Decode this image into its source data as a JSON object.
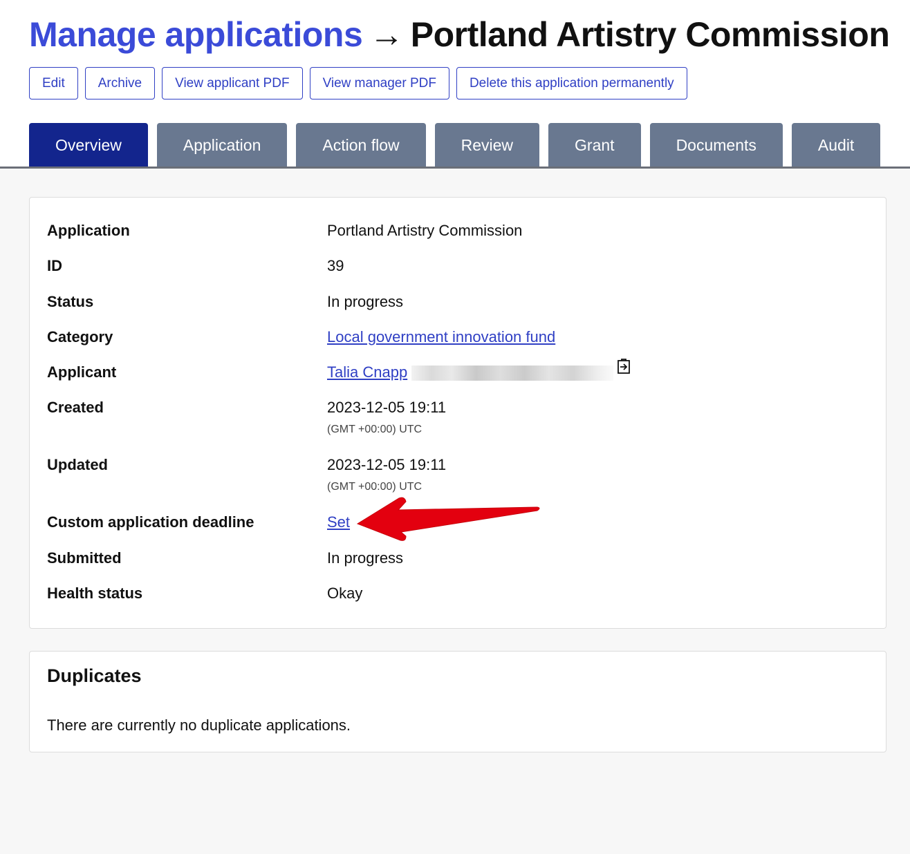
{
  "breadcrumb": {
    "parent": "Manage applications",
    "separator": "→",
    "current": "Portland Artistry Commission"
  },
  "actions": [
    {
      "label": "Edit"
    },
    {
      "label": "Archive"
    },
    {
      "label": "View applicant PDF"
    },
    {
      "label": "View manager PDF"
    },
    {
      "label": "Delete this application permanently"
    }
  ],
  "tabs": [
    {
      "label": "Overview",
      "active": true
    },
    {
      "label": "Application",
      "active": false
    },
    {
      "label": "Action flow",
      "active": false
    },
    {
      "label": "Review",
      "active": false
    },
    {
      "label": "Grant",
      "active": false
    },
    {
      "label": "Documents",
      "active": false
    },
    {
      "label": "Audit",
      "active": false
    }
  ],
  "overview": {
    "application": {
      "label": "Application",
      "value": "Portland Artistry Commission"
    },
    "id": {
      "label": "ID",
      "value": "39"
    },
    "status": {
      "label": "Status",
      "value": "In progress"
    },
    "category": {
      "label": "Category",
      "value": "Local government innovation fund"
    },
    "applicant": {
      "label": "Applicant",
      "value": "Talia Cnapp"
    },
    "created": {
      "label": "Created",
      "value": "2023-12-05 19:11",
      "timezone": "(GMT +00:00) UTC"
    },
    "updated": {
      "label": "Updated",
      "value": "2023-12-05 19:11",
      "timezone": "(GMT +00:00) UTC"
    },
    "deadline": {
      "label": "Custom application deadline",
      "value": "Set"
    },
    "submitted": {
      "label": "Submitted",
      "value": "In progress"
    },
    "health": {
      "label": "Health status",
      "value": "Okay"
    }
  },
  "duplicates": {
    "title": "Duplicates",
    "message": "There are currently no duplicate applications."
  },
  "colors": {
    "link": "#2f3fc4",
    "tab_active": "#13258d",
    "tab_inactive": "#697890",
    "annotation_arrow": "#e3000f"
  },
  "icons": {
    "applicant_action": "export-icon",
    "annotation": "red-arrow"
  }
}
